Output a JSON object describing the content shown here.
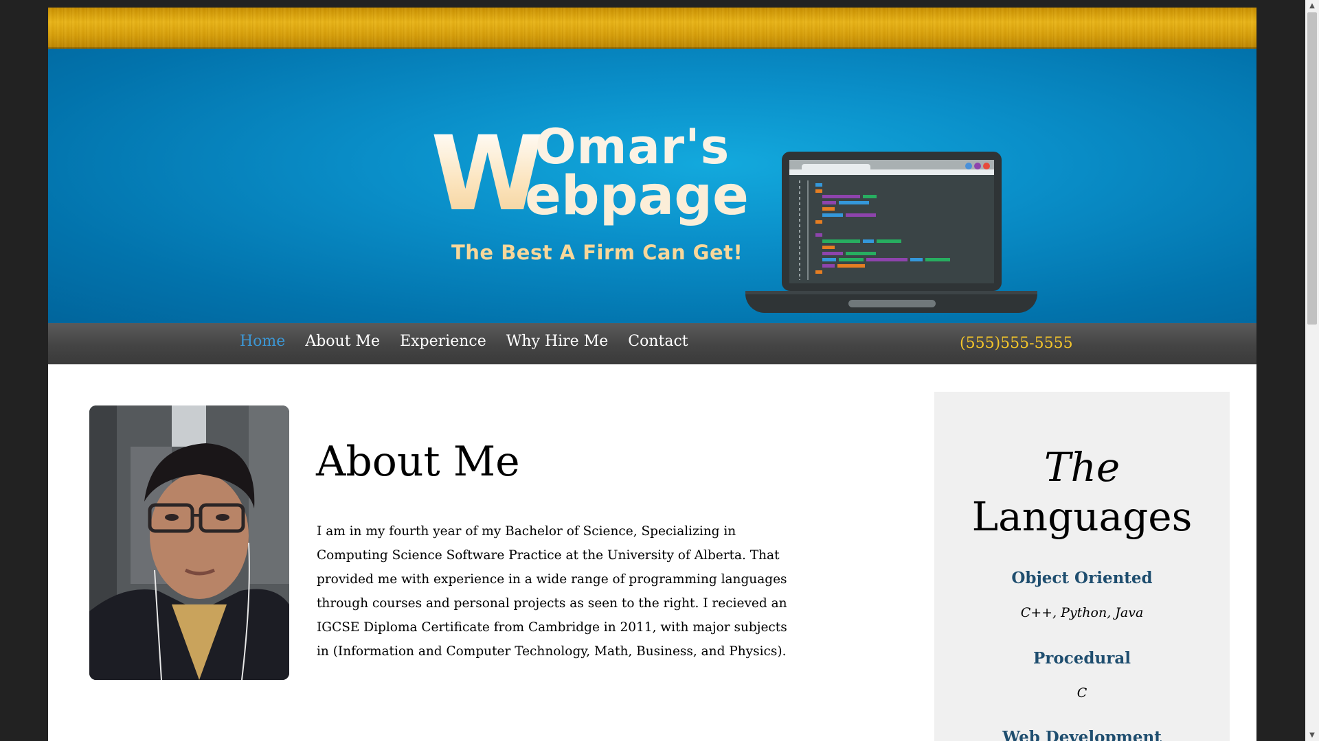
{
  "banner": {
    "logo_w": "W",
    "logo_line1": "Omar's",
    "logo_line2": "ebpage",
    "tagline": "The Best A Firm Can Get!"
  },
  "nav": {
    "items": [
      {
        "label": "Home",
        "active": true
      },
      {
        "label": "About Me",
        "active": false
      },
      {
        "label": "Experience",
        "active": false
      },
      {
        "label": "Why Hire Me",
        "active": false
      },
      {
        "label": "Contact",
        "active": false
      }
    ],
    "phone": "(555)555-5555"
  },
  "about": {
    "title": "About Me",
    "body": "I am in my fourth year of my Bachelor of Science, Specializing in Computing Science Software Practice at the University of Alberta. That provided me with experience in a wide range of programming languages through courses and personal projects as seen to the right. I recieved an IGCSE Diploma Certificate from Cambridge in 2011, with major subjects in (Information and Computer Technology, Math, Business, and Physics)."
  },
  "sidebar": {
    "title_the": "The",
    "title_main": "Languages",
    "categories": [
      {
        "name": "Object Oriented",
        "languages": "C++, Python, Java"
      },
      {
        "name": "Procedural",
        "languages": "C"
      },
      {
        "name": "Web Development",
        "languages": ""
      }
    ]
  },
  "colors": {
    "nav_active": "#3c97d5",
    "phone": "#f4c52a",
    "category_heading": "#1f4e6f",
    "banner_blue": "#0a8fc9"
  }
}
